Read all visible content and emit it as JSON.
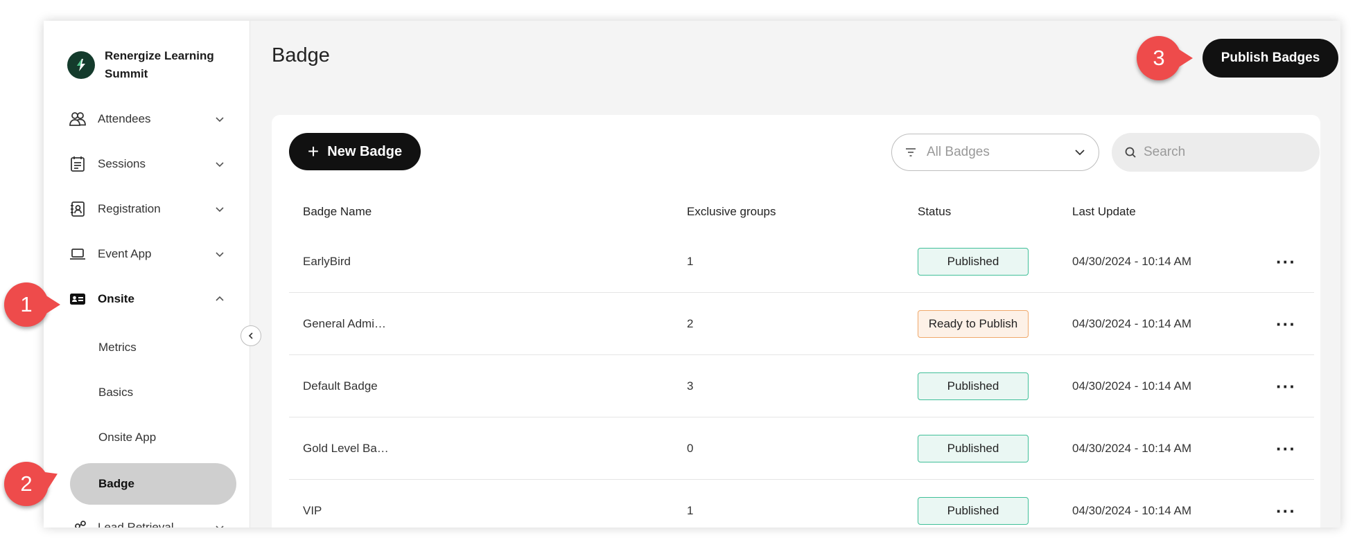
{
  "brand": {
    "name": "Renergize Learning Summit"
  },
  "sidebar": {
    "items": [
      {
        "label": "Attendees",
        "icon": "people-icon"
      },
      {
        "label": "Sessions",
        "icon": "calendar-list-icon"
      },
      {
        "label": "Registration",
        "icon": "contact-book-icon"
      },
      {
        "label": "Event App",
        "icon": "laptop-icon"
      },
      {
        "label": "Onsite",
        "icon": "id-card-icon",
        "expanded": true
      },
      {
        "label": "Lead Retrieval",
        "icon": "share-nodes-icon"
      }
    ],
    "onsite_sub": [
      {
        "label": "Metrics"
      },
      {
        "label": "Basics"
      },
      {
        "label": "Onsite App"
      },
      {
        "label": "Badge",
        "selected": true
      }
    ]
  },
  "header": {
    "title": "Badge",
    "publish_label": "Publish Badges"
  },
  "toolbar": {
    "new_badge_label": "New Badge",
    "filter_value": "All Badges",
    "search_placeholder": "Search"
  },
  "table": {
    "columns": [
      "Badge Name",
      "Exclusive groups",
      "Status",
      "Last Update"
    ],
    "rows": [
      {
        "name": "EarlyBird",
        "groups": "1",
        "status": "Published",
        "updated": "04/30/2024 - 10:14 AM"
      },
      {
        "name": "General Admi…",
        "groups": "2",
        "status": "Ready to Publish",
        "updated": "04/30/2024 - 10:14 AM"
      },
      {
        "name": "Default Badge",
        "groups": "3",
        "status": "Published",
        "updated": "04/30/2024 - 10:14 AM"
      },
      {
        "name": "Gold Level Ba…",
        "groups": "0",
        "status": "Published",
        "updated": "04/30/2024 - 10:14 AM"
      },
      {
        "name": "VIP",
        "groups": "1",
        "status": "Published",
        "updated": "04/30/2024 - 10:14 AM"
      }
    ],
    "more_glyph": "···"
  },
  "callouts": [
    "1",
    "2",
    "3"
  ],
  "colors": {
    "published_border": "#3fbf98",
    "ready_border": "#f0a86a",
    "callout": "#ee4b4b",
    "primary_button": "#111111"
  }
}
